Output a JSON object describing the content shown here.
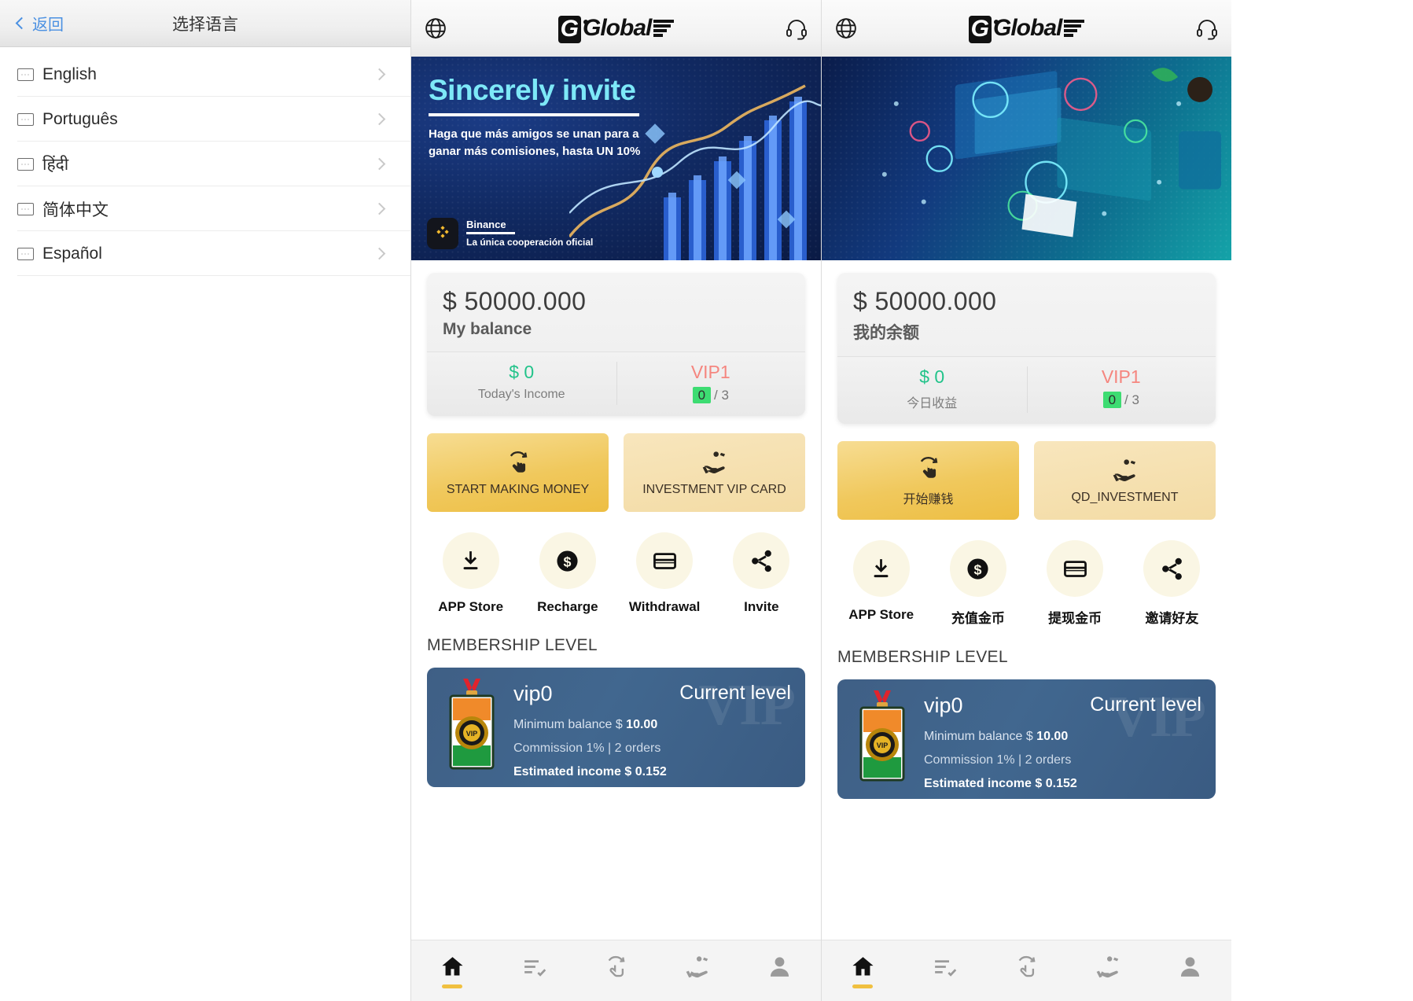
{
  "language_panel": {
    "back_label": "返回",
    "title": "选择语言",
    "items": [
      {
        "label": "English",
        "icon": "broken-image-icon"
      },
      {
        "label": "Português",
        "icon": "broken-image-icon"
      },
      {
        "label": "हिंदी",
        "icon": "broken-image-icon"
      },
      {
        "label": "简体中文",
        "icon": "broken-image-icon"
      },
      {
        "label": "Español",
        "icon": "broken-image-icon"
      }
    ]
  },
  "app_en": {
    "header": {
      "globe_icon": "globe-icon",
      "support_icon": "headset-icon",
      "brand": "Global"
    },
    "banner": {
      "title": "Sincerely invite",
      "subtitle": "Haga que más amigos se unan para a ganar más comisiones, hasta UN 10%",
      "partner_name": "Binance",
      "partner_tagline": "La única cooperación oficial"
    },
    "balance": {
      "amount": "$ 50000.000",
      "label": "My balance",
      "income_value": "$ 0",
      "income_label": "Today's Income",
      "vip_level": "VIP1",
      "vip_done": "0",
      "vip_total": "/ 3"
    },
    "cta": [
      {
        "label": "START MAKING MONEY",
        "icon": "tap-refresh-icon"
      },
      {
        "label": "INVESTMENT VIP CARD",
        "icon": "money-hand-icon"
      }
    ],
    "quick_actions": [
      {
        "label": "APP Store",
        "icon": "download-icon"
      },
      {
        "label": "Recharge",
        "icon": "dollar-circle-icon"
      },
      {
        "label": "Withdrawal",
        "icon": "credit-card-icon"
      },
      {
        "label": "Invite",
        "icon": "share-icon"
      }
    ],
    "membership": {
      "section_title": "MEMBERSHIP LEVEL",
      "watermark": "VIP",
      "level": "vip0",
      "current_badge": "Current level",
      "min_balance_prefix": "Minimum balance $ ",
      "min_balance": "10.00",
      "commission": "Commission 1% | 2 orders",
      "estimated_income": "Estimated income $ 0.152"
    },
    "nav": [
      {
        "icon": "home-icon",
        "active": true
      },
      {
        "icon": "task-list-icon",
        "active": false
      },
      {
        "icon": "tap-refresh-icon",
        "active": false
      },
      {
        "icon": "money-hand-icon",
        "active": false
      },
      {
        "icon": "person-icon",
        "active": false
      }
    ]
  },
  "app_zh": {
    "header": {
      "globe_icon": "globe-icon",
      "support_icon": "headset-icon",
      "brand": "Global"
    },
    "banner": {
      "title": "",
      "subtitle": "",
      "partner_name": "",
      "partner_tagline": ""
    },
    "balance": {
      "amount": "$ 50000.000",
      "label": "我的余额",
      "income_value": "$ 0",
      "income_label": "今日收益",
      "vip_level": "VIP1",
      "vip_done": "0",
      "vip_total": "/ 3"
    },
    "cta": [
      {
        "label": "开始赚钱",
        "icon": "tap-refresh-icon"
      },
      {
        "label": "QD_INVESTMENT",
        "icon": "money-hand-icon"
      }
    ],
    "quick_actions": [
      {
        "label": "APP Store",
        "icon": "download-icon"
      },
      {
        "label": "充值金币",
        "icon": "dollar-circle-icon"
      },
      {
        "label": "提现金币",
        "icon": "credit-card-icon"
      },
      {
        "label": "邀请好友",
        "icon": "share-icon"
      }
    ],
    "membership": {
      "section_title": "MEMBERSHIP LEVEL",
      "watermark": "VIP",
      "level": "vip0",
      "current_badge": "Current level",
      "min_balance_prefix": "Minimum balance $ ",
      "min_balance": "10.00",
      "commission": "Commission 1% | 2 orders",
      "estimated_income": "Estimated income $ 0.152"
    },
    "nav": [
      {
        "icon": "home-icon",
        "active": true
      },
      {
        "icon": "task-list-icon",
        "active": false
      },
      {
        "icon": "tap-refresh-icon",
        "active": false
      },
      {
        "icon": "money-hand-icon",
        "active": false
      },
      {
        "icon": "person-icon",
        "active": false
      }
    ]
  },
  "colors": {
    "accent_gold": "#edbe43",
    "income_green": "#22c38a",
    "vip_red": "#f5867f",
    "progress_green": "#3ddc72",
    "link_blue": "#4a90e2",
    "card_blue": "#41678f"
  }
}
